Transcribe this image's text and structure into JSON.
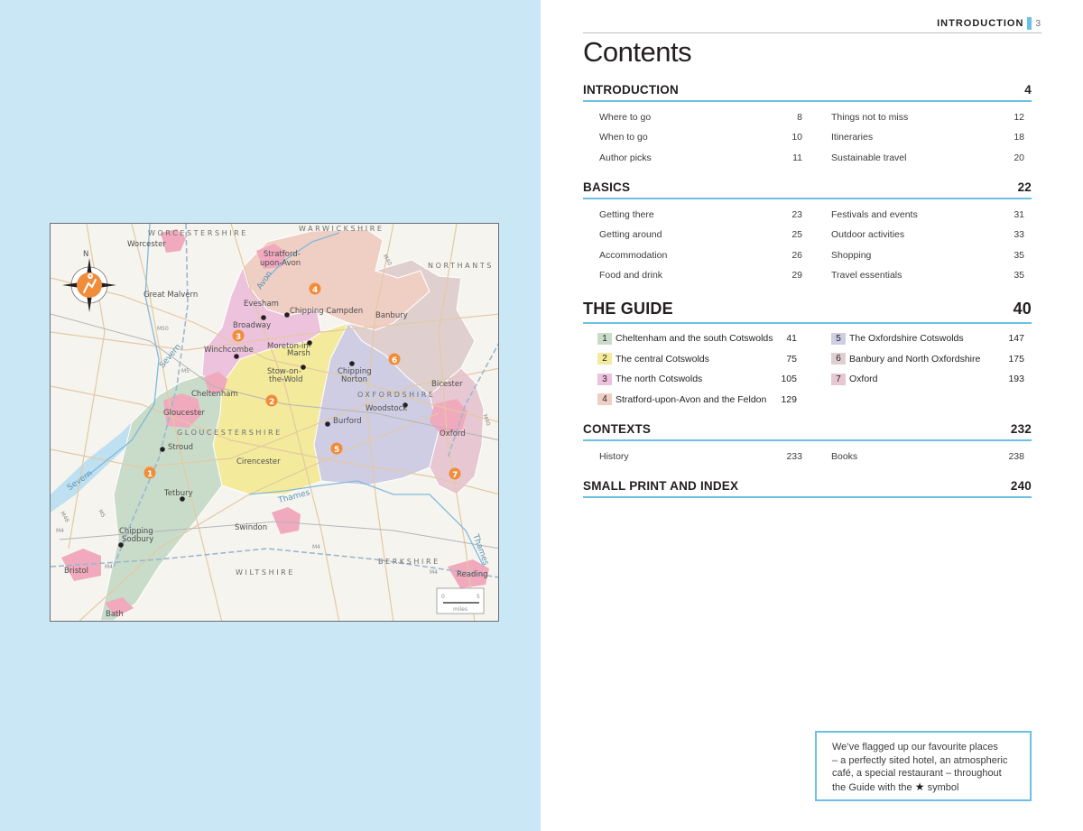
{
  "running_head": {
    "label": "INTRODUCTION",
    "page_number": "3"
  },
  "title": "Contents",
  "sections": {
    "introduction": {
      "title": "INTRODUCTION",
      "page": "4",
      "left": [
        {
          "label": "Where to go",
          "page": "8"
        },
        {
          "label": "When to go",
          "page": "10"
        },
        {
          "label": "Author picks",
          "page": "11"
        }
      ],
      "right": [
        {
          "label": "Things not to miss",
          "page": "12"
        },
        {
          "label": "Itineraries",
          "page": "18"
        },
        {
          "label": "Sustainable travel",
          "page": "20"
        }
      ]
    },
    "basics": {
      "title": "BASICS",
      "page": "22",
      "left": [
        {
          "label": "Getting there",
          "page": "23"
        },
        {
          "label": "Getting around",
          "page": "25"
        },
        {
          "label": "Accommodation",
          "page": "26"
        },
        {
          "label": "Food and drink",
          "page": "29"
        }
      ],
      "right": [
        {
          "label": "Festivals and events",
          "page": "31"
        },
        {
          "label": "Outdoor activities",
          "page": "33"
        },
        {
          "label": "Shopping",
          "page": "35"
        },
        {
          "label": "Travel essentials",
          "page": "35"
        }
      ]
    },
    "guide": {
      "title": "THE GUIDE",
      "page": "40",
      "left": [
        {
          "num": "1",
          "label": "Cheltenham and the south Cotswolds",
          "page": "41",
          "color": "#c9dcc9"
        },
        {
          "num": "2",
          "label": "The central Cotswolds",
          "page": "75",
          "color": "#f4ea9c"
        },
        {
          "num": "3",
          "label": "The north Cotswolds",
          "page": "105",
          "color": "#ecc2dc"
        },
        {
          "num": "4",
          "label": "Stratford-upon-Avon and the Feldon",
          "page": "129",
          "color": "#efcfc3"
        }
      ],
      "right": [
        {
          "num": "5",
          "label": "The Oxfordshire Cotswolds",
          "page": "147",
          "color": "#cfcde3"
        },
        {
          "num": "6",
          "label": "Banbury and North Oxfordshire",
          "page": "175",
          "color": "#dfd0cf"
        },
        {
          "num": "7",
          "label": "Oxford",
          "page": "193",
          "color": "#e7c8d2"
        }
      ]
    },
    "contexts": {
      "title": "CONTEXTS",
      "page": "232",
      "left": [
        {
          "label": "History",
          "page": "233"
        }
      ],
      "right": [
        {
          "label": "Books",
          "page": "238"
        }
      ]
    },
    "small_print": {
      "title": "SMALL PRINT AND INDEX",
      "page": "240"
    }
  },
  "note": {
    "line1": "We’ve flagged up our favourite places",
    "line2": "– a perfectly sited hotel, an atmospheric",
    "line3": "café, a special restaurant – throughout",
    "line4_before": "the Guide with the",
    "line4_after": "symbol",
    "star": "★"
  },
  "map": {
    "counties": [
      "WORCESTERSHIRE",
      "WARWICKSHIRE",
      "NORTHANTS",
      "OXFORDSHIRE",
      "GLOUCESTERSHIRE",
      "WILTSHIRE",
      "BERKSHIRE"
    ],
    "rivers": [
      "Severn",
      "Avon",
      "Thames",
      "Severn",
      "Thames"
    ],
    "towns": [
      "Worcester",
      "Great Malvern",
      "Stratford-",
      "upon-Avon",
      "Evesham",
      "Broadway",
      "Chipping Campden",
      "Banbury",
      "Winchcombe",
      "Moreton-in-",
      "Marsh",
      "Stow-on-",
      "the-Wold",
      "Chipping",
      "Norton",
      "Bicester",
      "Cheltenham",
      "Woodstock",
      "Gloucester",
      "Burford",
      "Oxford",
      "Stroud",
      "Cirencester",
      "Tetbury",
      "Swindon",
      "Chipping",
      "Sodbury",
      "Bristol",
      "Reading",
      "Bath"
    ],
    "roads": [
      "M50",
      "M5",
      "M40",
      "M4",
      "M4",
      "M4",
      "M48",
      "M4",
      "M5",
      "M40"
    ],
    "compass": "N",
    "scale": {
      "zero": "0",
      "five": "5",
      "unit": "miles"
    },
    "regions": [
      "1",
      "2",
      "3",
      "4",
      "5",
      "6",
      "7"
    ]
  }
}
